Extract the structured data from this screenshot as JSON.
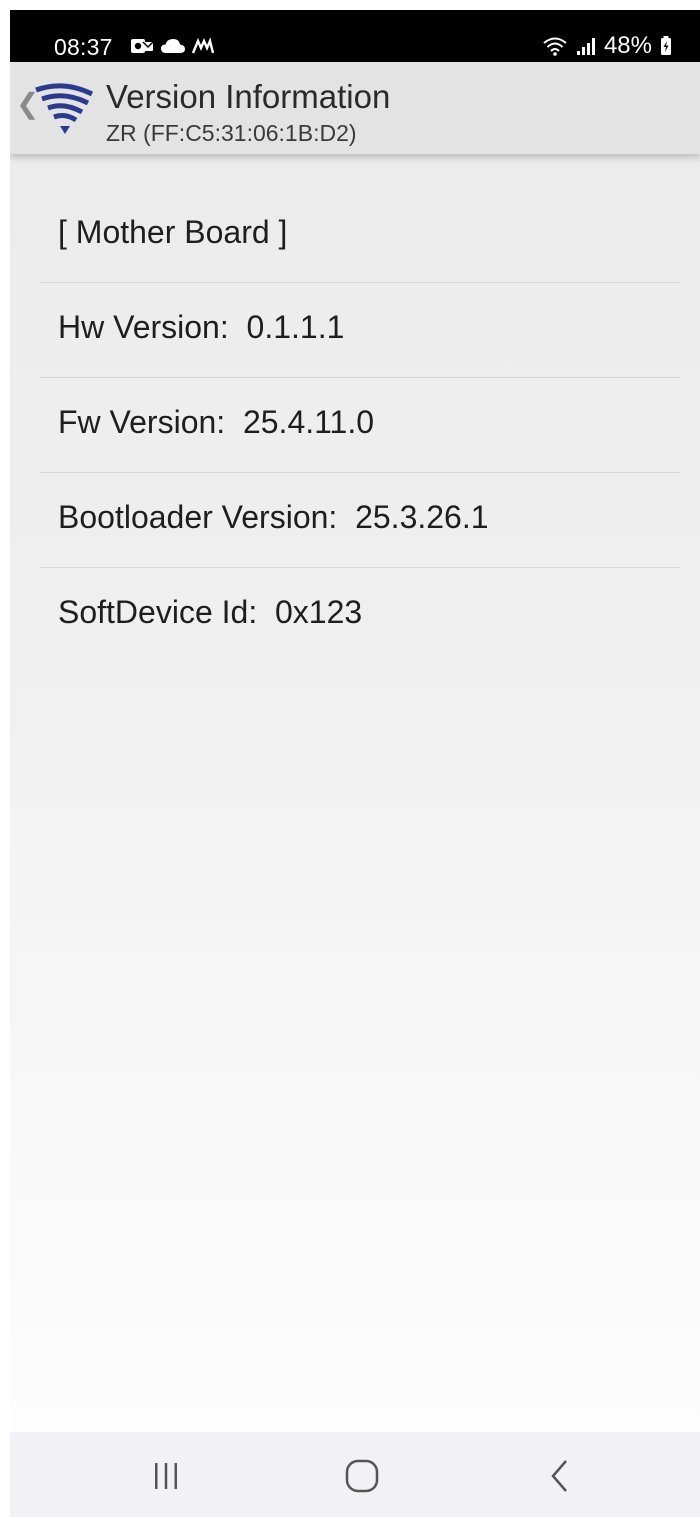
{
  "status_bar": {
    "time": "08:37",
    "battery": "48%",
    "left_icons": [
      "outlook-icon",
      "cloud-icon",
      "app-icon"
    ],
    "right_icons": [
      "wifi-icon",
      "signal-icon",
      "battery-icon"
    ]
  },
  "app_bar": {
    "title": "Version Information",
    "subtitle": "ZR (FF:C5:31:06:1B:D2)",
    "logo_color": "#2b3a8f"
  },
  "version_list": {
    "items": [
      {
        "text": "[ Mother Board ]"
      },
      {
        "text": "Hw Version:  0.1.1.1"
      },
      {
        "text": "Fw Version:  25.4.11.0"
      },
      {
        "text": "Bootloader Version:  25.3.26.1"
      },
      {
        "text": "SoftDevice Id:  0x123"
      }
    ]
  },
  "nav_bar": {
    "buttons": [
      "recents-icon",
      "home-icon",
      "back-icon"
    ]
  }
}
